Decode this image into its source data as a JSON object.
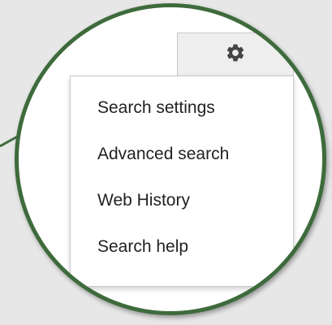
{
  "colors": {
    "background": "#e7e7e7",
    "lens_border": "#3e6b3c",
    "menu_text": "#222222",
    "gear_icon": "#444444",
    "button_bg": "#eeeeee"
  },
  "toolbar": {
    "settings_icon": "gear-icon"
  },
  "menu": {
    "items": [
      {
        "label": "Search settings"
      },
      {
        "label": "Advanced search"
      },
      {
        "label": "Web History"
      },
      {
        "label": "Search help"
      }
    ]
  }
}
